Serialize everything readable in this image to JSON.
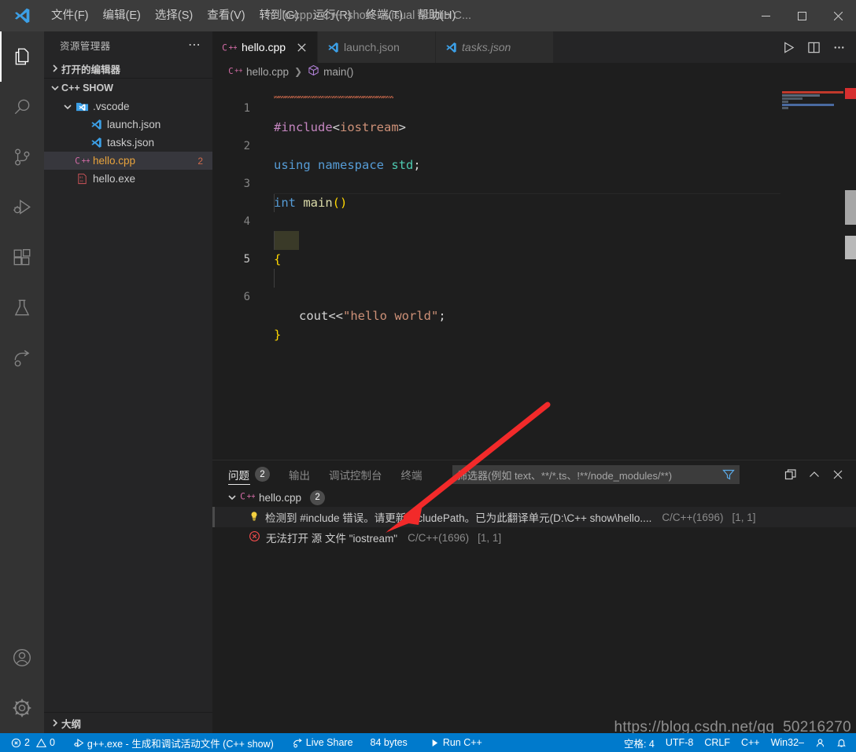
{
  "window": {
    "title": "hello.cpp - C++ show - Visual Studio C...",
    "logo_icon": "vscode-logo-icon",
    "controls": [
      {
        "name": "minimize-button",
        "icon": "minimize-icon"
      },
      {
        "name": "maximize-button",
        "icon": "maximize-icon"
      },
      {
        "name": "close-button",
        "icon": "close-icon"
      }
    ]
  },
  "menubar": {
    "items": [
      {
        "label": "文件(F)",
        "name": "menu-file"
      },
      {
        "label": "编辑(E)",
        "name": "menu-edit"
      },
      {
        "label": "选择(S)",
        "name": "menu-selection"
      },
      {
        "label": "查看(V)",
        "name": "menu-view"
      },
      {
        "label": "转到(G)",
        "name": "menu-go"
      },
      {
        "label": "运行(R)",
        "name": "menu-run"
      },
      {
        "label": "终端(T)",
        "name": "menu-terminal"
      },
      {
        "label": "帮助(H)",
        "name": "menu-help"
      }
    ]
  },
  "activity_bar": {
    "items": [
      {
        "name": "activity-explorer",
        "icon": "files-icon",
        "active": true
      },
      {
        "name": "activity-search",
        "icon": "search-icon",
        "active": false
      },
      {
        "name": "activity-source-control",
        "icon": "source-control-icon",
        "active": false
      },
      {
        "name": "activity-run-debug",
        "icon": "run-debug-icon",
        "active": false
      },
      {
        "name": "activity-extensions",
        "icon": "extensions-icon",
        "active": false
      },
      {
        "name": "activity-testing",
        "icon": "beaker-icon",
        "active": false
      },
      {
        "name": "activity-remote",
        "icon": "remote-explorer-icon",
        "active": false
      }
    ],
    "bottom_items": [
      {
        "name": "activity-accounts",
        "icon": "account-icon"
      },
      {
        "name": "activity-settings",
        "icon": "gear-icon"
      }
    ]
  },
  "sidebar": {
    "title": "资源管理器",
    "more_actions": "⋯",
    "sections": [
      {
        "name": "open-editors-section",
        "label": "打开的编辑器",
        "expanded": false
      },
      {
        "name": "workspace-section",
        "label": "C++ SHOW",
        "expanded": true
      }
    ],
    "tree": [
      {
        "label": ".vscode",
        "icon": "vscode-folder-icon",
        "indent": 2,
        "expanded": true,
        "badge": "",
        "selected": false,
        "color": "normal"
      },
      {
        "label": "launch.json",
        "icon": "vscode-file-icon",
        "indent": 3,
        "badge": "",
        "selected": false,
        "color": "normal"
      },
      {
        "label": "tasks.json",
        "icon": "vscode-file-icon",
        "indent": 3,
        "badge": "",
        "selected": false,
        "color": "normal"
      },
      {
        "label": "hello.cpp",
        "icon": "cpp-icon",
        "indent": 2,
        "badge": "2",
        "selected": true,
        "color": "orange"
      },
      {
        "label": "hello.exe",
        "icon": "binary-icon",
        "indent": 2,
        "badge": "",
        "selected": false,
        "color": "normal"
      }
    ],
    "outline_label": "大纲"
  },
  "editor": {
    "tabs": [
      {
        "label": "hello.cpp",
        "icon": "cpp-icon",
        "active": true,
        "italic": false,
        "closable": true
      },
      {
        "label": "launch.json",
        "icon": "vscode-file-icon",
        "active": false,
        "italic": false,
        "closable": false
      },
      {
        "label": "tasks.json",
        "icon": "vscode-file-icon",
        "active": false,
        "italic": true,
        "closable": false
      }
    ],
    "tab_actions": [
      {
        "name": "run-code-button",
        "icon": "play-icon"
      },
      {
        "name": "split-editor-button",
        "icon": "split-editor-icon"
      },
      {
        "name": "editor-more-actions-button",
        "icon": "ellipsis-icon"
      }
    ],
    "breadcrumbs": [
      {
        "label": "hello.cpp",
        "icon": "cpp-icon"
      },
      {
        "label": "main()",
        "icon": "symbol-method-icon"
      }
    ],
    "line_numbers": [
      "1",
      "2",
      "3",
      "4",
      "5",
      "6"
    ],
    "code": [
      "#include<iostream>",
      "using namespace std;",
      "int main()",
      "{",
      "    cout<<\"hello world\";",
      "}"
    ]
  },
  "panel": {
    "tabs": [
      {
        "label": "问题",
        "count": "2",
        "active": true,
        "name": "panel-tab-problems"
      },
      {
        "label": "输出",
        "count": "",
        "active": false,
        "name": "panel-tab-output"
      },
      {
        "label": "调试控制台",
        "count": "",
        "active": false,
        "name": "panel-tab-debug-console"
      },
      {
        "label": "终端",
        "count": "",
        "active": false,
        "name": "panel-tab-terminal"
      }
    ],
    "filter": {
      "placeholder": "筛选器(例如 text、**/*.ts、!**/node_modules/**)",
      "value": "",
      "icon": "filter-icon"
    },
    "actions": [
      {
        "name": "maximize-panel-size-button",
        "icon": "copy-panel-icon"
      },
      {
        "name": "collapse-panel-button",
        "icon": "chevron-up-icon"
      },
      {
        "name": "close-panel-button",
        "icon": "close-icon"
      }
    ],
    "problems": {
      "file": {
        "label": "hello.cpp",
        "count": "2",
        "icon": "cpp-icon",
        "expanded": true
      },
      "items": [
        {
          "severity": "warning",
          "icon": "lightbulb-icon",
          "message": "检测到 #include 错误。请更新 includePath。已为此翻译单元(D:\\C++ show\\hello....",
          "source": "C/C++(1696)",
          "position": "[1, 1]",
          "highlighted": true
        },
        {
          "severity": "error",
          "icon": "error-icon",
          "message": "无法打开 源 文件 \"iostream\"",
          "source": "C/C++(1696)",
          "position": "[1, 1]",
          "highlighted": false
        }
      ]
    }
  },
  "status_bar": {
    "left": [
      {
        "name": "status-problems",
        "icon": "error-icon",
        "label": "2",
        "icon2": "warning-icon",
        "label2": "0"
      },
      {
        "name": "status-build-task",
        "icon": "debug-alt-icon",
        "label": "g++.exe - 生成和调试活动文件 (C++ show)"
      },
      {
        "name": "status-live-share",
        "icon": "live-share-icon",
        "label": "Live Share"
      },
      {
        "name": "status-file-size",
        "icon": "",
        "label": "84 bytes"
      },
      {
        "name": "status-run-cpp",
        "icon": "play-icon",
        "label": "Run C++"
      }
    ],
    "right": [
      {
        "name": "status-indentation",
        "label": "空格: 4"
      },
      {
        "name": "status-encoding",
        "label": "UTF-8"
      },
      {
        "name": "status-eol",
        "label": "CRLF"
      },
      {
        "name": "status-language-mode",
        "label": "C++"
      },
      {
        "name": "status-platform",
        "label": "Win32–"
      },
      {
        "name": "status-account",
        "icon": "account-icon",
        "label": ""
      },
      {
        "name": "status-notifications",
        "icon": "bell-icon",
        "label": ""
      }
    ]
  },
  "annotations": {
    "arrow": {
      "color": "#f22a2a",
      "name": "red-arrow-annotation"
    },
    "watermark": "https://blog.csdn.net/qq_50216270"
  },
  "colors": {
    "accent": "#007acc",
    "titlebar_bg": "#3c3c3c",
    "activitybar_bg": "#333333",
    "sidebar_bg": "#252526",
    "editor_bg": "#1e1e1e",
    "selected_row": "#37373d",
    "error": "#f14c4c",
    "warning": "#cca700"
  }
}
